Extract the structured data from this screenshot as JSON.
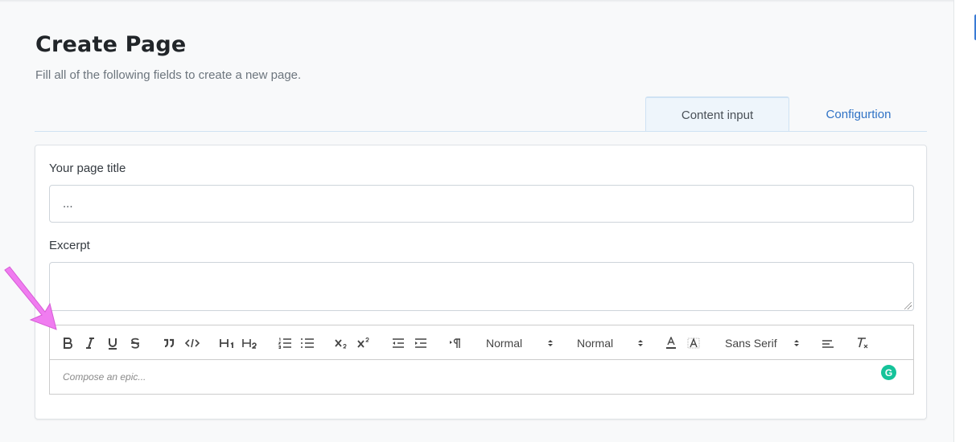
{
  "header": {
    "title": "Create Page",
    "subtitle": "Fill all of the following fields to create a new page."
  },
  "tabs": [
    {
      "label": "Content input",
      "active": true
    },
    {
      "label": "Configurtion",
      "active": false
    }
  ],
  "form": {
    "title_label": "Your page title",
    "title_value": "...",
    "excerpt_label": "Excerpt",
    "excerpt_value": ""
  },
  "editor": {
    "placeholder": "Compose an epic...",
    "header_picker": "Normal",
    "size_picker": "Normal",
    "font_picker": "Sans Serif",
    "toolbar_icons": [
      "bold-icon",
      "italic-icon",
      "underline-icon",
      "strike-icon",
      "blockquote-icon",
      "code-block-icon",
      "h1-icon",
      "h2-icon",
      "ordered-list-icon",
      "bullet-list-icon",
      "subscript-icon",
      "superscript-icon",
      "outdent-icon",
      "indent-icon",
      "rtl-direction-icon",
      "text-color-icon",
      "background-color-icon",
      "align-icon",
      "clear-format-icon"
    ]
  },
  "colors": {
    "accent": "#2f72c5",
    "annotation_arrow": "#f07cf0",
    "grammarly": "#15c39a"
  }
}
